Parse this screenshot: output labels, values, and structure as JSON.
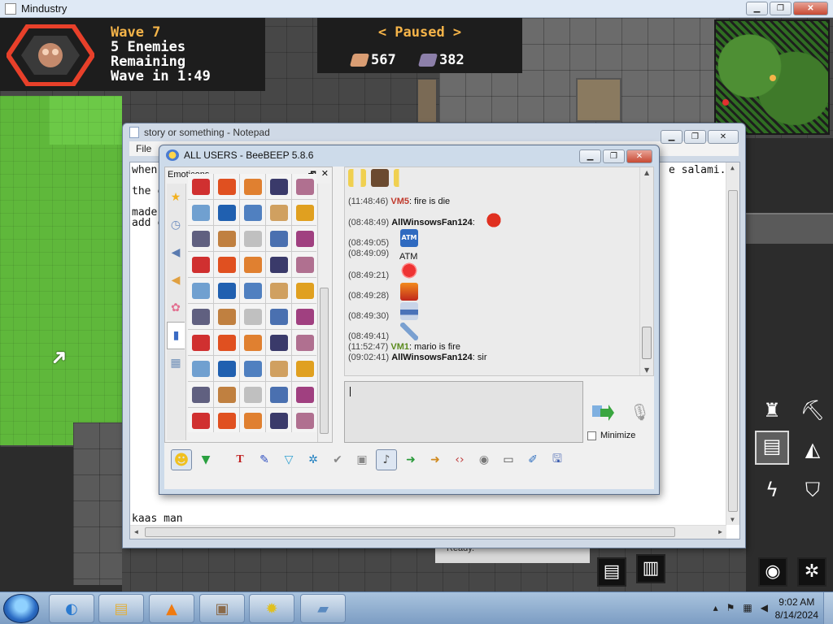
{
  "mindustry": {
    "window_title": "Mindustry",
    "wave": {
      "title": "Wave 7",
      "enemies": "5 Enemies",
      "remaining": "Remaining",
      "countdown": "Wave in 1:49"
    },
    "status": "< Paused >",
    "resources": [
      {
        "icon": "copper-icon",
        "value": "567",
        "color": "#d99d73"
      },
      {
        "icon": "lead-icon",
        "value": "382",
        "color": "#8c7fa9"
      }
    ],
    "behind_text": "Ready.",
    "accent_color": "#f5b449"
  },
  "notepad": {
    "title": "story or something - Notepad",
    "menu_file": "File",
    "lines": [
      "when",
      "the c",
      "made",
      "add c",
      "kaas man"
    ],
    "line_right": "e salami."
  },
  "beebeep": {
    "title": "ALL USERS - BeeBEEP 5.8.6",
    "emoticons_title": "Emoticons",
    "chat": [
      {
        "ts": "(11:48:46)",
        "user": "VM5",
        "sep": ":",
        "text": "fire is die",
        "color": "red"
      },
      {
        "ts": "(08:48:49)",
        "user": "AllWinsowsFan124",
        "sep": ":",
        "text": "",
        "color": "black"
      },
      {
        "ts": "(08:49:05)",
        "user": "",
        "sep": "",
        "text": "",
        "color": "black"
      },
      {
        "ts": "(08:49:09)",
        "user": "",
        "sep": "",
        "text": "",
        "color": "black"
      },
      {
        "ts": "(08:49:21)",
        "user": "",
        "sep": "",
        "text": "",
        "color": "black"
      },
      {
        "ts": "(08:49:28)",
        "user": "",
        "sep": "",
        "text": "",
        "color": "black"
      },
      {
        "ts": "(08:49:30)",
        "user": "",
        "sep": "",
        "text": "",
        "color": "black"
      },
      {
        "ts": "(08:49:41)",
        "user": "",
        "sep": "",
        "text": "",
        "color": "black"
      },
      {
        "ts": "(11:52:47)",
        "user": "VM1",
        "sep": ":",
        "text": "mario is fire",
        "color": "green"
      },
      {
        "ts": "(09:02:41)",
        "user": "AllWinsowsFan124",
        "sep": ":",
        "text": "sir",
        "color": "black"
      }
    ],
    "atm_label": "ATM",
    "minimize_label": "Minimize"
  },
  "taskbar": {
    "time": "9:02 AM",
    "date": "8/14/2024"
  }
}
